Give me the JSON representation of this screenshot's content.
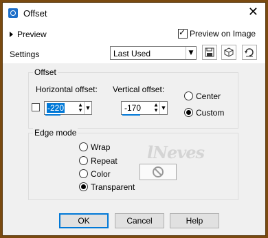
{
  "window": {
    "title": "Offset",
    "close_glyph": "✕"
  },
  "preview": {
    "label": "Preview",
    "on_image_label": "Preview on Image",
    "on_image_checked": true
  },
  "settings": {
    "label": "Settings",
    "selected": "Last Used"
  },
  "toolbar": {
    "icons": [
      "save-preset-icon",
      "cube-icon",
      "reset-icon"
    ]
  },
  "offset": {
    "group_title": "Offset",
    "horizontal_label": "Horizontal offset:",
    "horizontal_value": "-220",
    "vertical_label": "Vertical offset:",
    "vertical_value": "-170",
    "options": [
      "Center",
      "Custom"
    ],
    "selected_option": "Custom"
  },
  "edge_mode": {
    "group_title": "Edge mode",
    "options": [
      "Wrap",
      "Repeat",
      "Color",
      "Transparent"
    ],
    "selected_option": "Transparent"
  },
  "watermark": "lNeves",
  "buttons": {
    "ok": "OK",
    "cancel": "Cancel",
    "help": "Help"
  },
  "colors": {
    "accent": "#0078d7",
    "outer_frame": "#7a4a10"
  }
}
